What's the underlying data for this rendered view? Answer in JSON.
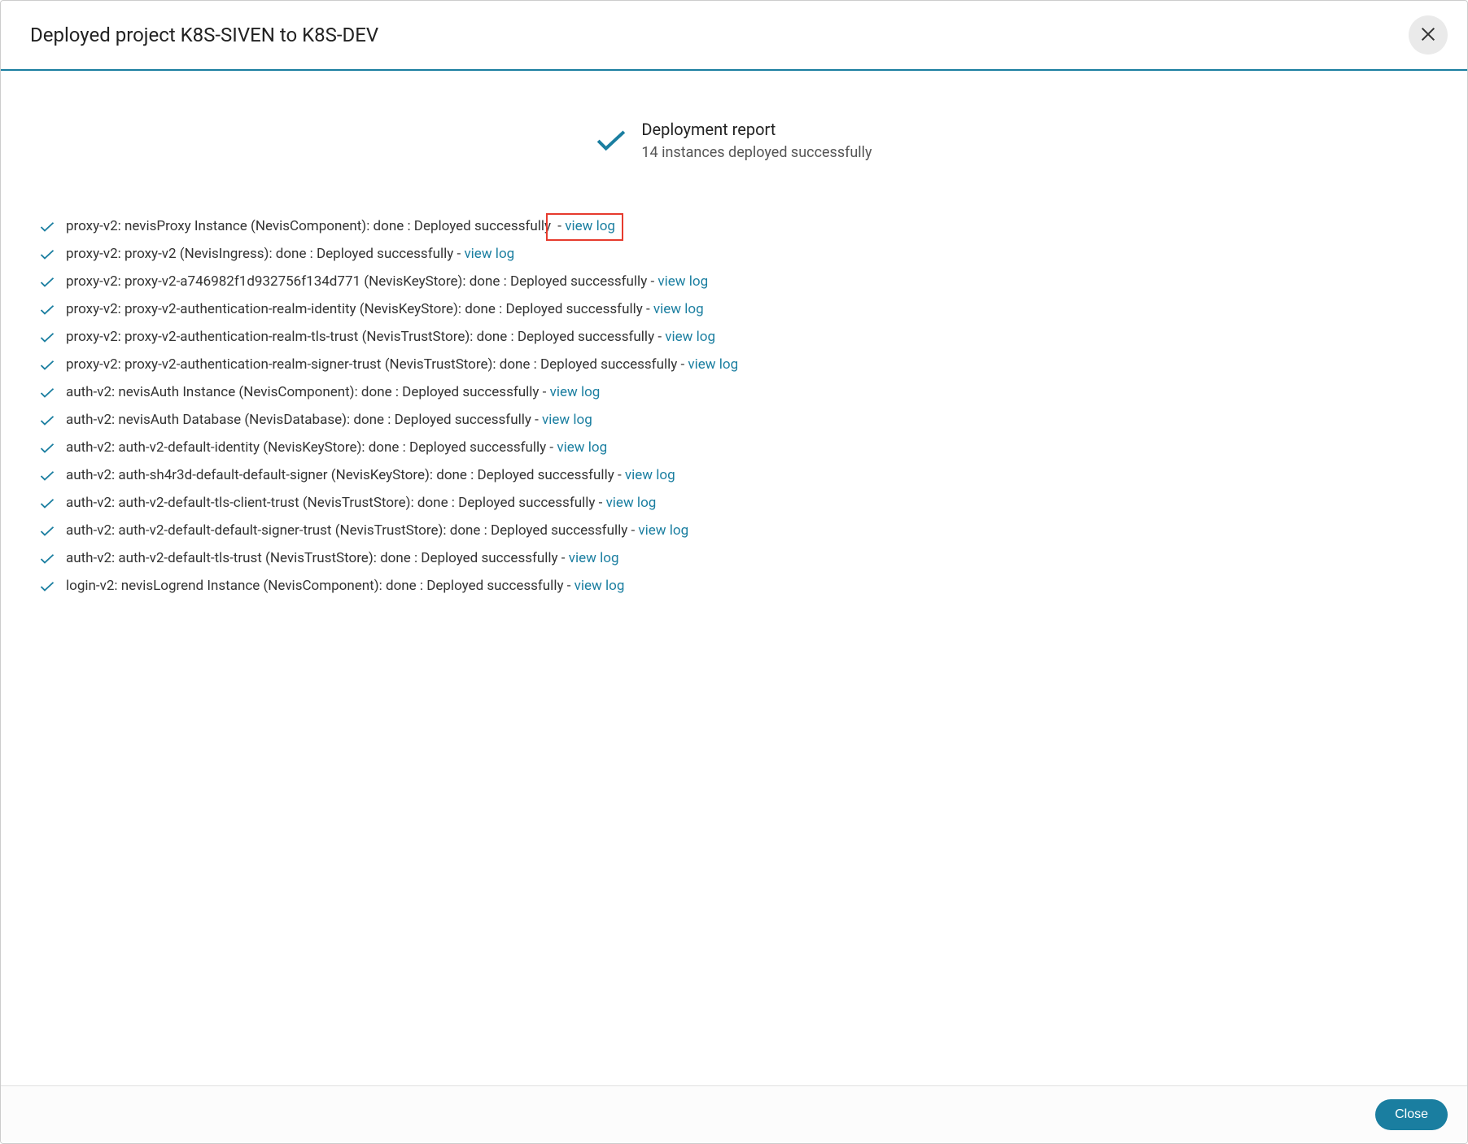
{
  "modal": {
    "title": "Deployed project K8S-SIVEN to K8S-DEV",
    "close_button_label": "Close"
  },
  "report": {
    "title": "Deployment report",
    "subtitle": "14 instances deployed successfully",
    "view_log_label": "view log",
    "items": [
      {
        "text": "proxy-v2: nevisProxy Instance (NevisComponent): done : Deployed successfully",
        "highlighted": true
      },
      {
        "text": "proxy-v2: proxy-v2 (NevisIngress): done : Deployed successfully",
        "highlighted": false
      },
      {
        "text": "proxy-v2: proxy-v2-a746982f1d932756f134d771 (NevisKeyStore): done : Deployed successfully",
        "highlighted": false
      },
      {
        "text": "proxy-v2: proxy-v2-authentication-realm-identity (NevisKeyStore): done : Deployed successfully",
        "highlighted": false
      },
      {
        "text": "proxy-v2: proxy-v2-authentication-realm-tls-trust (NevisTrustStore): done : Deployed successfully",
        "highlighted": false
      },
      {
        "text": "proxy-v2: proxy-v2-authentication-realm-signer-trust (NevisTrustStore): done : Deployed successfully",
        "highlighted": false
      },
      {
        "text": "auth-v2: nevisAuth Instance (NevisComponent): done : Deployed successfully",
        "highlighted": false
      },
      {
        "text": "auth-v2: nevisAuth Database (NevisDatabase): done : Deployed successfully",
        "highlighted": false
      },
      {
        "text": "auth-v2: auth-v2-default-identity (NevisKeyStore): done : Deployed successfully",
        "highlighted": false
      },
      {
        "text": "auth-v2: auth-sh4r3d-default-default-signer (NevisKeyStore): done : Deployed successfully",
        "highlighted": false
      },
      {
        "text": "auth-v2: auth-v2-default-tls-client-trust (NevisTrustStore): done : Deployed successfully",
        "highlighted": false
      },
      {
        "text": "auth-v2: auth-v2-default-default-signer-trust (NevisTrustStore): done : Deployed successfully",
        "highlighted": false
      },
      {
        "text": "auth-v2: auth-v2-default-tls-trust (NevisTrustStore): done : Deployed successfully",
        "highlighted": false
      },
      {
        "text": "login-v2: nevisLogrend Instance (NevisComponent): done : Deployed successfully",
        "highlighted": false
      }
    ]
  }
}
